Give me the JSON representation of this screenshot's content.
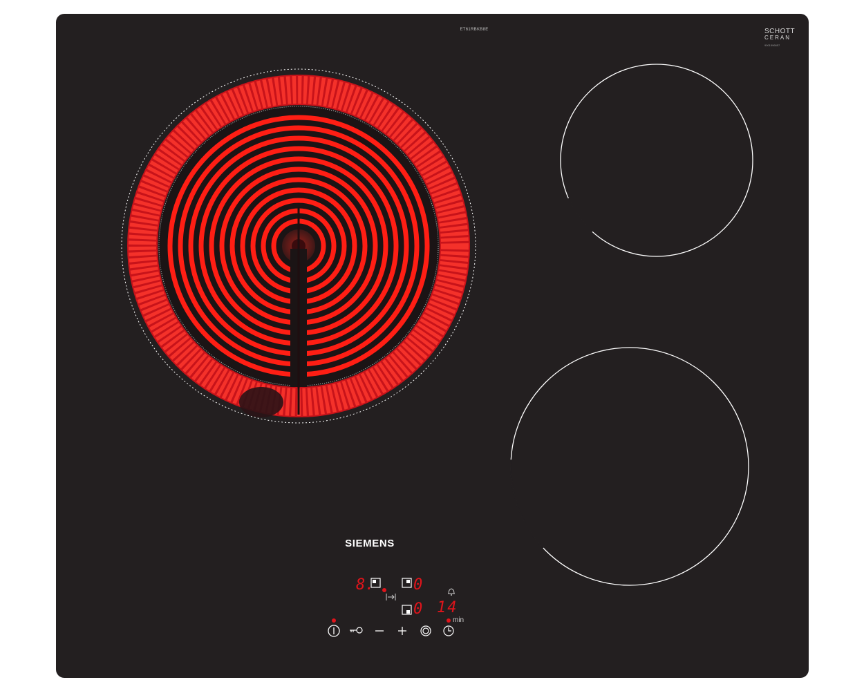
{
  "hob": {
    "model_code": "ET61RBKB8E",
    "glass_brand": {
      "line1": "SCHOTT",
      "line2": "CERAN",
      "code": "9001596657"
    },
    "brand": "SIEMENS",
    "zones": [
      {
        "name": "front-left",
        "state": "glowing"
      },
      {
        "name": "rear-right",
        "state": "off"
      },
      {
        "name": "front-right",
        "state": "off"
      }
    ]
  },
  "controls": {
    "displays": {
      "zone_left_level": "8.",
      "zone_right_rear_level": "0",
      "zone_right_front_level": "0",
      "timer_value": "14",
      "timer_unit": "min"
    },
    "buttons": [
      {
        "name": "power-icon"
      },
      {
        "name": "key-lock-icon"
      },
      {
        "name": "minus-icon"
      },
      {
        "name": "plus-icon"
      },
      {
        "name": "zone-select-icon"
      },
      {
        "name": "timer-clock-icon"
      }
    ],
    "indicator_icons": [
      "bell-icon",
      "extend-zone-icon"
    ]
  },
  "colors": {
    "glass": "#231f20",
    "heat": "#ff2a1f",
    "display": "#e0141b",
    "lines": "#ffffff"
  }
}
